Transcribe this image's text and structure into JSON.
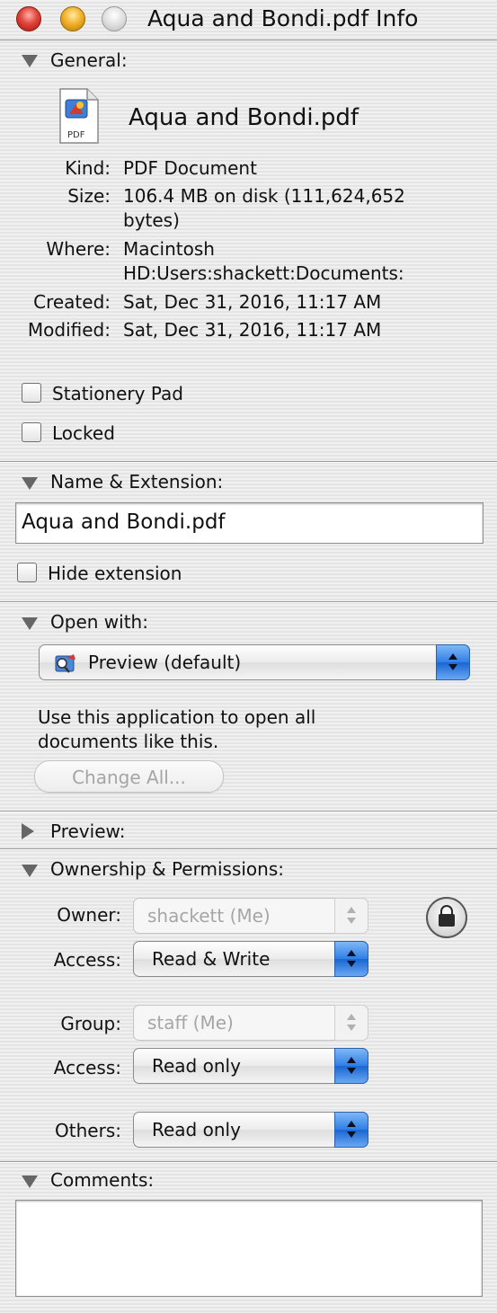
{
  "window": {
    "title": "Aqua and Bondi.pdf Info"
  },
  "general": {
    "section_title": "General:",
    "file_name": "Aqua and Bondi.pdf",
    "icon_label": "PDF",
    "kind_label": "Kind:",
    "kind_value": "PDF Document",
    "size_label": "Size:",
    "size_value_line1": "106.4 MB on disk (111,624,652",
    "size_value_line2": "bytes)",
    "where_label": "Where:",
    "where_value_line1": "Macintosh",
    "where_value_line2": "HD:Users:shackett:Documents:",
    "created_label": "Created:",
    "created_value": "Sat, Dec 31, 2016, 11:17 AM",
    "modified_label": "Modified:",
    "modified_value": "Sat, Dec 31, 2016, 11:17 AM",
    "stationery_label": "Stationery Pad",
    "stationery_checked": false,
    "locked_label": "Locked",
    "locked_checked": false
  },
  "name_extension": {
    "section_title": "Name & Extension:",
    "field_value": "Aqua and Bondi.pdf",
    "hide_extension_label": "Hide extension",
    "hide_extension_checked": false
  },
  "open_with": {
    "section_title": "Open with:",
    "selected_app": "Preview (default)",
    "description_line1": "Use this application to open all",
    "description_line2": "documents like this.",
    "change_all_label": "Change All..."
  },
  "preview": {
    "section_title": "Preview:"
  },
  "ownership": {
    "section_title": "Ownership & Permissions:",
    "owner_label": "Owner:",
    "owner_value": "shackett (Me)",
    "owner_access_label": "Access:",
    "owner_access_value": "Read & Write",
    "group_label": "Group:",
    "group_value": "staff (Me)",
    "group_access_label": "Access:",
    "group_access_value": "Read only",
    "others_label": "Others:",
    "others_value": "Read only"
  },
  "comments": {
    "section_title": "Comments:",
    "text": ""
  }
}
